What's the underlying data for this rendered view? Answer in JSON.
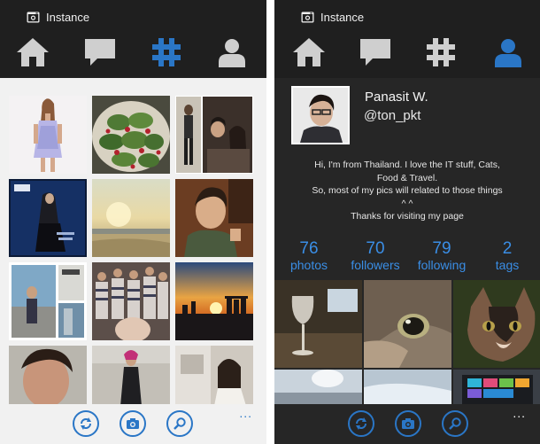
{
  "left_screen": {
    "app_title": "Instance",
    "nav": {
      "active": "hashtag",
      "tabs": [
        "home",
        "comments",
        "hashtag",
        "profile"
      ]
    },
    "appbar": {
      "buttons": [
        "refresh",
        "camera",
        "search"
      ],
      "more_label": "..."
    }
  },
  "right_screen": {
    "app_title": "Instance",
    "nav": {
      "active": "profile",
      "tabs": [
        "home",
        "comments",
        "hashtag",
        "profile"
      ]
    },
    "profile": {
      "name": "Panasit W.",
      "handle": "@ton_pkt",
      "bio": [
        "Hi, I'm from Thailand. I love the IT stuff, Cats,",
        "Food & Travel.",
        "So, most of my pics will related to those things",
        "^ ^",
        "Thanks for visiting my page"
      ]
    },
    "stats": [
      {
        "value": "76",
        "label": "photos"
      },
      {
        "value": "70",
        "label": "followers"
      },
      {
        "value": "79",
        "label": "following"
      },
      {
        "value": "2",
        "label": "tags"
      }
    ],
    "appbar": {
      "buttons": [
        "refresh",
        "camera",
        "search"
      ],
      "more_label": "..."
    }
  },
  "theme": {
    "accent": "#2a76c6",
    "stat_color": "#3a8ee6",
    "topbar_bg": "#1f1f1f",
    "profile_bg": "#262626",
    "icon_inactive": "#cfcfcf"
  }
}
